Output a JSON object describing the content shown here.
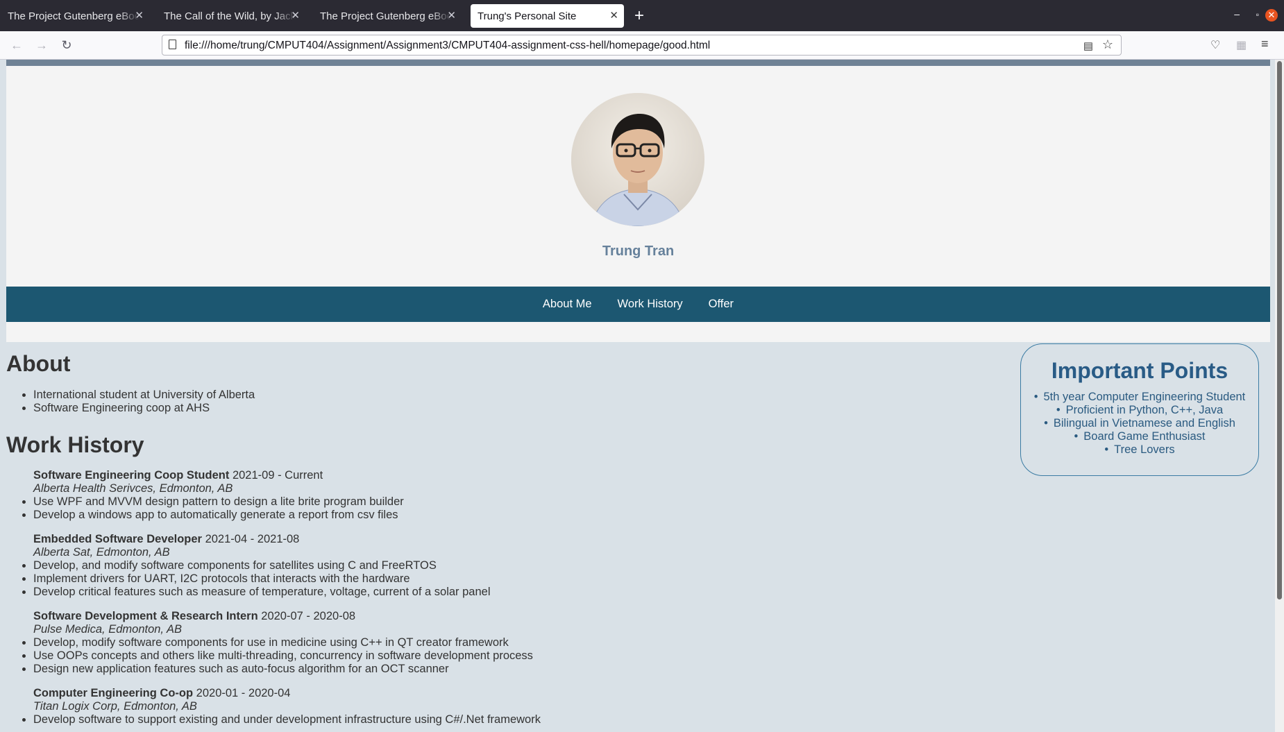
{
  "browser": {
    "tabs": [
      {
        "title": "The Project Gutenberg eBoo",
        "active": false
      },
      {
        "title": "The Call of the Wild, by Jack",
        "active": false
      },
      {
        "title": "The Project Gutenberg eBoo",
        "active": false
      },
      {
        "title": "Trung's Personal Site",
        "active": true
      }
    ],
    "url": "file:///home/trung/CMPUT404/Assignment/Assignment3/CMPUT404-assignment-css-hell/homepage/good.html"
  },
  "site": {
    "name": "Trung Tran",
    "nav": [
      "About Me",
      "Work History",
      "Offer"
    ]
  },
  "about": {
    "heading": "About",
    "items": [
      "International student at University of Alberta",
      "Software Engineering coop at AHS"
    ]
  },
  "work": {
    "heading": "Work History",
    "jobs": [
      {
        "title": "Software Engineering Coop Student",
        "dates": "2021-09 - Current",
        "company": "Alberta Health Serivces, Edmonton, AB",
        "bullets": [
          "Use WPF and MVVM design pattern to design a lite brite program builder",
          "Develop a windows app to automatically generate a report from csv files"
        ]
      },
      {
        "title": "Embedded Software Developer",
        "dates": "2021-04 - 2021-08",
        "company": "Alberta Sat, Edmonton, AB",
        "bullets": [
          "Develop, and modify software components for satellites using C and FreeRTOS",
          "Implement drivers for UART, I2C protocols that interacts with the hardware",
          "Develop critical features such as measure of temperature, voltage, current of a solar panel"
        ]
      },
      {
        "title": "Software Development & Research Intern",
        "dates": "2020-07 - 2020-08",
        "company": "Pulse Medica, Edmonton, AB",
        "bullets": [
          "Develop, modify software components for use in medicine using C++ in QT creator framework",
          "Use OOPs concepts and others like multi-threading, concurrency in software development process",
          "Design new application features such as auto-focus algorithm for an OCT scanner"
        ]
      },
      {
        "title": "Computer Engineering Co-op",
        "dates": "2020-01 - 2020-04",
        "company": "Titan Logix Corp, Edmonton, AB",
        "bullets": [
          "Develop software to support existing and under development infrastructure using C#/.Net framework"
        ]
      }
    ]
  },
  "points": {
    "heading": "Important Points",
    "items": [
      "5th year Computer Engineering Student",
      "Proficient in Python, C++, Java",
      "Bilingual in Vietnamese and English",
      "Board Game Enthusiast",
      "Tree Lovers"
    ]
  },
  "colors": {
    "nav_bg": "#1c5771",
    "name_color": "#66819b",
    "points_color": "#295b86",
    "content_bg": "#d9e1e7"
  }
}
